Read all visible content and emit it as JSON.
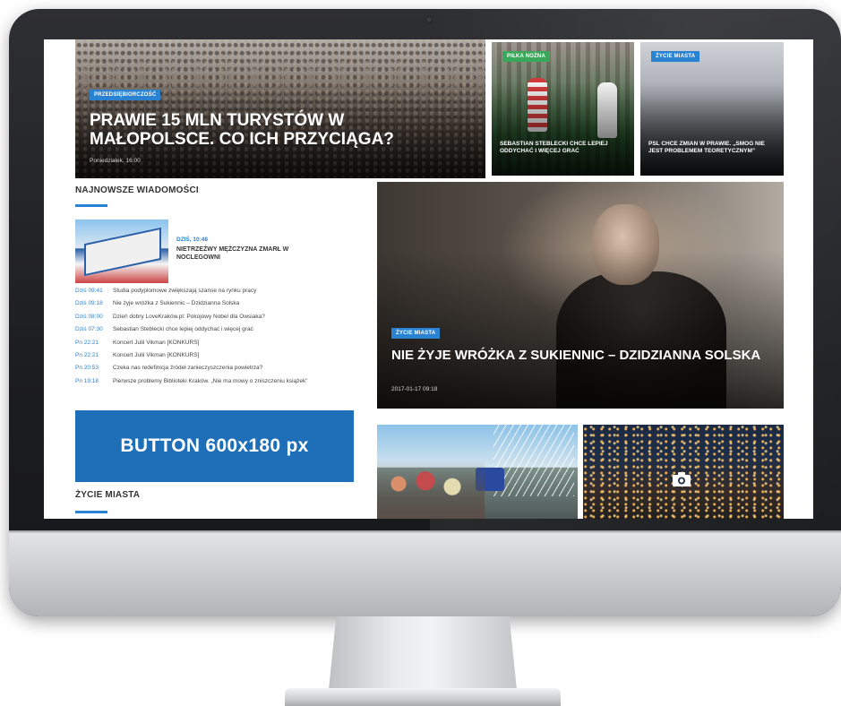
{
  "hero": {
    "badge": "PRZEDSIĘBIORCZOŚĆ",
    "title": "PRAWIE 15 MLN TURYSTÓW W MAŁOPOLSCE. CO ICH PRZYCIĄGA?",
    "date": "Poniedziałek, 16:00"
  },
  "top_tiles": [
    {
      "badge": "PIŁKA NOŻNA",
      "title": "SEBASTIAN STEBLECKI CHCE LEPIEJ ODDYCHAĆ I WIĘCEJ GRAĆ"
    },
    {
      "badge": "ŻYCIE MIASTA",
      "title": "PSL CHCE ZMIAN W PRAWIE. „SMOG NIE JEST PROBLEMEM TEORETYCZNYM”"
    }
  ],
  "latest": {
    "section_title": "NAJNOWSZE WIADOMOŚCI",
    "featured": {
      "time": "DZIŚ, 10:48",
      "title": "NIETRZEŹWY MĘŻCZYZNA ZMARŁ W NOCLEGOWNI"
    },
    "items": [
      {
        "time": "Dziś 09:41",
        "text": "Studia podyplomowe zwiększają szanse na rynku pracy"
      },
      {
        "time": "Dziś 09:18",
        "text": "Nie żyje wróżka z Sukiennic – Dzidzianna Solska"
      },
      {
        "time": "Dziś 08:00",
        "text": "Dzień dobry LoveKraków.pl: Pokojowy Nobel dla Owsiaka?"
      },
      {
        "time": "Dziś 07:30",
        "text": "Sebastian Steblecki chce lepiej oddychać i więcej grać"
      },
      {
        "time": "Pn 22:21",
        "text": "Koncert Julii Vikman [KONKURS]"
      },
      {
        "time": "Pn 22:21",
        "text": "Koncert Julii Vikman [KONKURS]"
      },
      {
        "time": "Pn 20:53",
        "text": "Czeka nas redefinicja źródeł zanieczyszczenia powietrza?"
      },
      {
        "time": "Pn 19:18",
        "text": "Pierwsze problemy Biblioteki Kraków. „Nie ma mowy o zniszczeniu książek”"
      }
    ]
  },
  "promo": {
    "label": "BUTTON 600x180 px"
  },
  "main_story": {
    "badge": "ŻYCIE MIASTA",
    "title": "NIE ŻYJE WRÓŻKA Z SUKIENNIC – DZIDZIANNA SOLSKA",
    "date": "2017-01-17 09:18"
  },
  "section2": {
    "title": "ŻYCIE MIASTA"
  },
  "icons": {
    "gallery": "camera-icon"
  },
  "colors": {
    "accent": "#2a82d2",
    "promo": "#1f6fb8",
    "badge_green": "#3aa85a"
  }
}
